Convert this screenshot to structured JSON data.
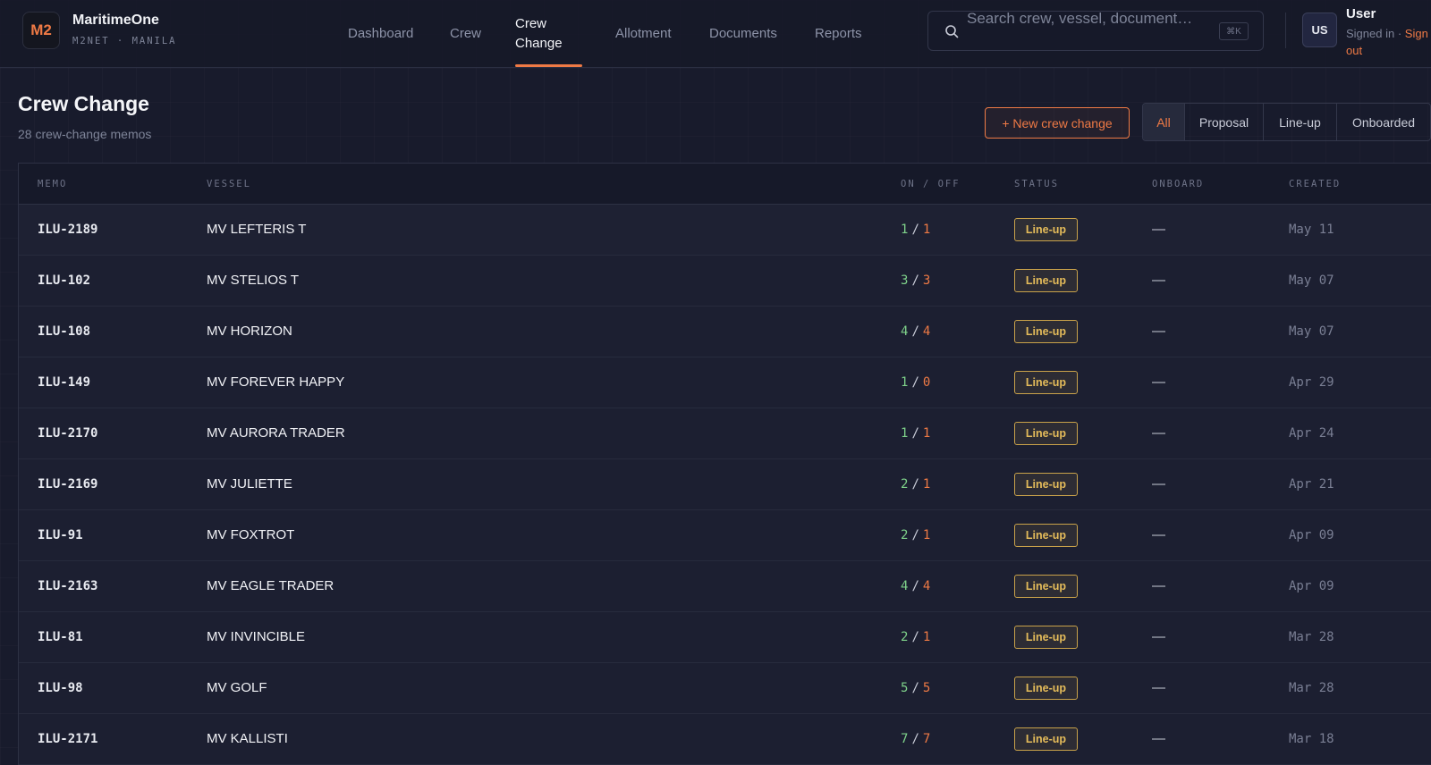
{
  "brand": {
    "logo": "M2",
    "name": "MaritimeOne",
    "sub": "M2NET · MANILA"
  },
  "nav": [
    {
      "label": "Dashboard"
    },
    {
      "label": "Crew"
    },
    {
      "label": "Crew Change"
    },
    {
      "label": "Allotment"
    },
    {
      "label": "Documents"
    },
    {
      "label": "Reports"
    }
  ],
  "nav_active": "Crew Change",
  "search": {
    "placeholder": "Search crew, vessel, document…",
    "shortcut": "⌘K"
  },
  "user": {
    "initials": "US",
    "name": "User",
    "status": "Signed in ·",
    "signout": "Sign out"
  },
  "page": {
    "title": "Crew Change",
    "subtitle": "28 crew-change memos",
    "new_button": "+ New crew change"
  },
  "filters": [
    {
      "label": "All"
    },
    {
      "label": "Proposal"
    },
    {
      "label": "Line-up"
    },
    {
      "label": "Onboarded"
    }
  ],
  "filter_active": "All",
  "table": {
    "columns": [
      "MEMO",
      "VESSEL",
      "ON / OFF",
      "STATUS",
      "ONBOARD",
      "CREATED"
    ],
    "rows": [
      {
        "memo": "ILU-2189",
        "vessel": "MV LEFTERIS T",
        "on": "1",
        "off": "1",
        "status": "Line-up",
        "onboard": "—",
        "created": "May 11"
      },
      {
        "memo": "ILU-102",
        "vessel": "MV STELIOS T",
        "on": "3",
        "off": "3",
        "status": "Line-up",
        "onboard": "—",
        "created": "May 07"
      },
      {
        "memo": "ILU-108",
        "vessel": "MV HORIZON",
        "on": "4",
        "off": "4",
        "status": "Line-up",
        "onboard": "—",
        "created": "May 07"
      },
      {
        "memo": "ILU-149",
        "vessel": "MV FOREVER HAPPY",
        "on": "1",
        "off": "0",
        "status": "Line-up",
        "onboard": "—",
        "created": "Apr 29"
      },
      {
        "memo": "ILU-2170",
        "vessel": "MV AURORA TRADER",
        "on": "1",
        "off": "1",
        "status": "Line-up",
        "onboard": "—",
        "created": "Apr 24"
      },
      {
        "memo": "ILU-2169",
        "vessel": "MV JULIETTE",
        "on": "2",
        "off": "1",
        "status": "Line-up",
        "onboard": "—",
        "created": "Apr 21"
      },
      {
        "memo": "ILU-91",
        "vessel": "MV FOXTROT",
        "on": "2",
        "off": "1",
        "status": "Line-up",
        "onboard": "—",
        "created": "Apr 09"
      },
      {
        "memo": "ILU-2163",
        "vessel": "MV EAGLE TRADER",
        "on": "4",
        "off": "4",
        "status": "Line-up",
        "onboard": "—",
        "created": "Apr 09"
      },
      {
        "memo": "ILU-81",
        "vessel": "MV INVINCIBLE",
        "on": "2",
        "off": "1",
        "status": "Line-up",
        "onboard": "—",
        "created": "Mar 28"
      },
      {
        "memo": "ILU-98",
        "vessel": "MV GOLF",
        "on": "5",
        "off": "5",
        "status": "Line-up",
        "onboard": "—",
        "created": "Mar 28"
      },
      {
        "memo": "ILU-2171",
        "vessel": "MV KALLISTI",
        "on": "7",
        "off": "7",
        "status": "Line-up",
        "onboard": "—",
        "created": "Mar 18"
      }
    ]
  },
  "colors": {
    "accent": "#ef7a45",
    "on": "#7fd28a",
    "off": "#ef7a45",
    "badge": "#e5bc5a",
    "background": "#181b2c"
  }
}
